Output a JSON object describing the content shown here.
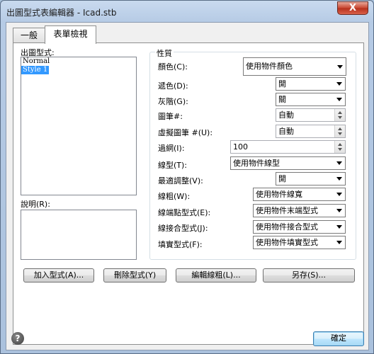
{
  "window": {
    "title": "出圖型式表編輯器 - Icad.stb",
    "close_label": "X"
  },
  "tabs": [
    {
      "label": "一般"
    },
    {
      "label": "表單檢視"
    }
  ],
  "plot_styles": {
    "label": "出圖型式:",
    "items": [
      {
        "label": "Normal",
        "selected": false
      },
      {
        "label": "Style 1",
        "selected": true
      }
    ]
  },
  "description": {
    "label": "說明(R):",
    "value": ""
  },
  "properties": {
    "title": "性質",
    "color": {
      "label": "顏色(C):",
      "value": "使用物件顏色"
    },
    "dither": {
      "label": "遞色(D):",
      "value": "開"
    },
    "grayscale": {
      "label": "灰階(G):",
      "value": "關"
    },
    "pen": {
      "label": "圖筆#:",
      "value": "自動"
    },
    "virtual_pen": {
      "label": "虛擬圖筆 #(U):",
      "value": "自動"
    },
    "screening": {
      "label": "過網(I):",
      "value": "100"
    },
    "linetype": {
      "label": "線型(T):",
      "value": "使用物件線型"
    },
    "adaptive": {
      "label": "最適調整(V):",
      "value": "開"
    },
    "lineweight": {
      "label": "線粗(W):",
      "value": "使用物件線寬"
    },
    "line_end": {
      "label": "線端點型式(E):",
      "value": "使用物件末端型式"
    },
    "line_join": {
      "label": "線接合型式(J):",
      "value": "使用物件接合型式"
    },
    "fill_style": {
      "label": "填實型式(F):",
      "value": "使用物件填實型式"
    }
  },
  "buttons": {
    "add_style": "加入型式(A)...",
    "delete_style": "刪除型式(Y)",
    "edit_lineweights": "編輯線粗(L)...",
    "save_as": "另存(S)...",
    "ok": "確定",
    "help": "?"
  }
}
